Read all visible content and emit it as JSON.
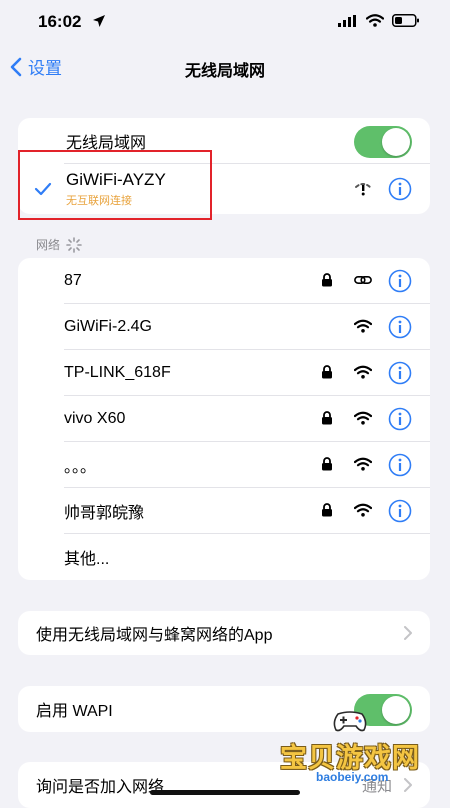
{
  "status": {
    "time": "16:02"
  },
  "nav": {
    "back_label": "设置",
    "title": "无线局域网"
  },
  "wlan": {
    "toggle_label": "无线局域网",
    "toggle_on": true,
    "connected": {
      "name": "GiWiFi-AYZY",
      "status": "无互联网连接"
    }
  },
  "networks": {
    "header": "网络",
    "items": [
      {
        "name": "87",
        "icons": [
          "lock-icon",
          "link-icon"
        ]
      },
      {
        "name": "GiWiFi-2.4G",
        "icons": [
          "wifi-icon"
        ]
      },
      {
        "name": "TP-LINK_618F",
        "icons": [
          "lock-icon",
          "wifi-icon"
        ]
      },
      {
        "name": "vivo X60",
        "icons": [
          "lock-icon",
          "wifi-icon"
        ]
      },
      {
        "name": "。。。",
        "icons": [
          "lock-icon",
          "wifi-icon"
        ]
      },
      {
        "name": "帅哥郭皖豫",
        "icons": [
          "lock-icon",
          "wifi-icon"
        ]
      }
    ],
    "other": "其他..."
  },
  "apps_row": {
    "label": "使用无线局域网与蜂窝网络的App"
  },
  "wapi": {
    "label": "启用 WAPI",
    "toggle_on": true
  },
  "ask_join": {
    "label": "询问是否加入网络",
    "value": "通知"
  },
  "watermark": {
    "text": "宝贝游戏网",
    "url": "baobeiy.com"
  },
  "colors": {
    "accent": "#2f7df6",
    "toggle_on": "#5fbf6a",
    "highlight": "#e2232a",
    "status_warning": "#e8a33d"
  }
}
